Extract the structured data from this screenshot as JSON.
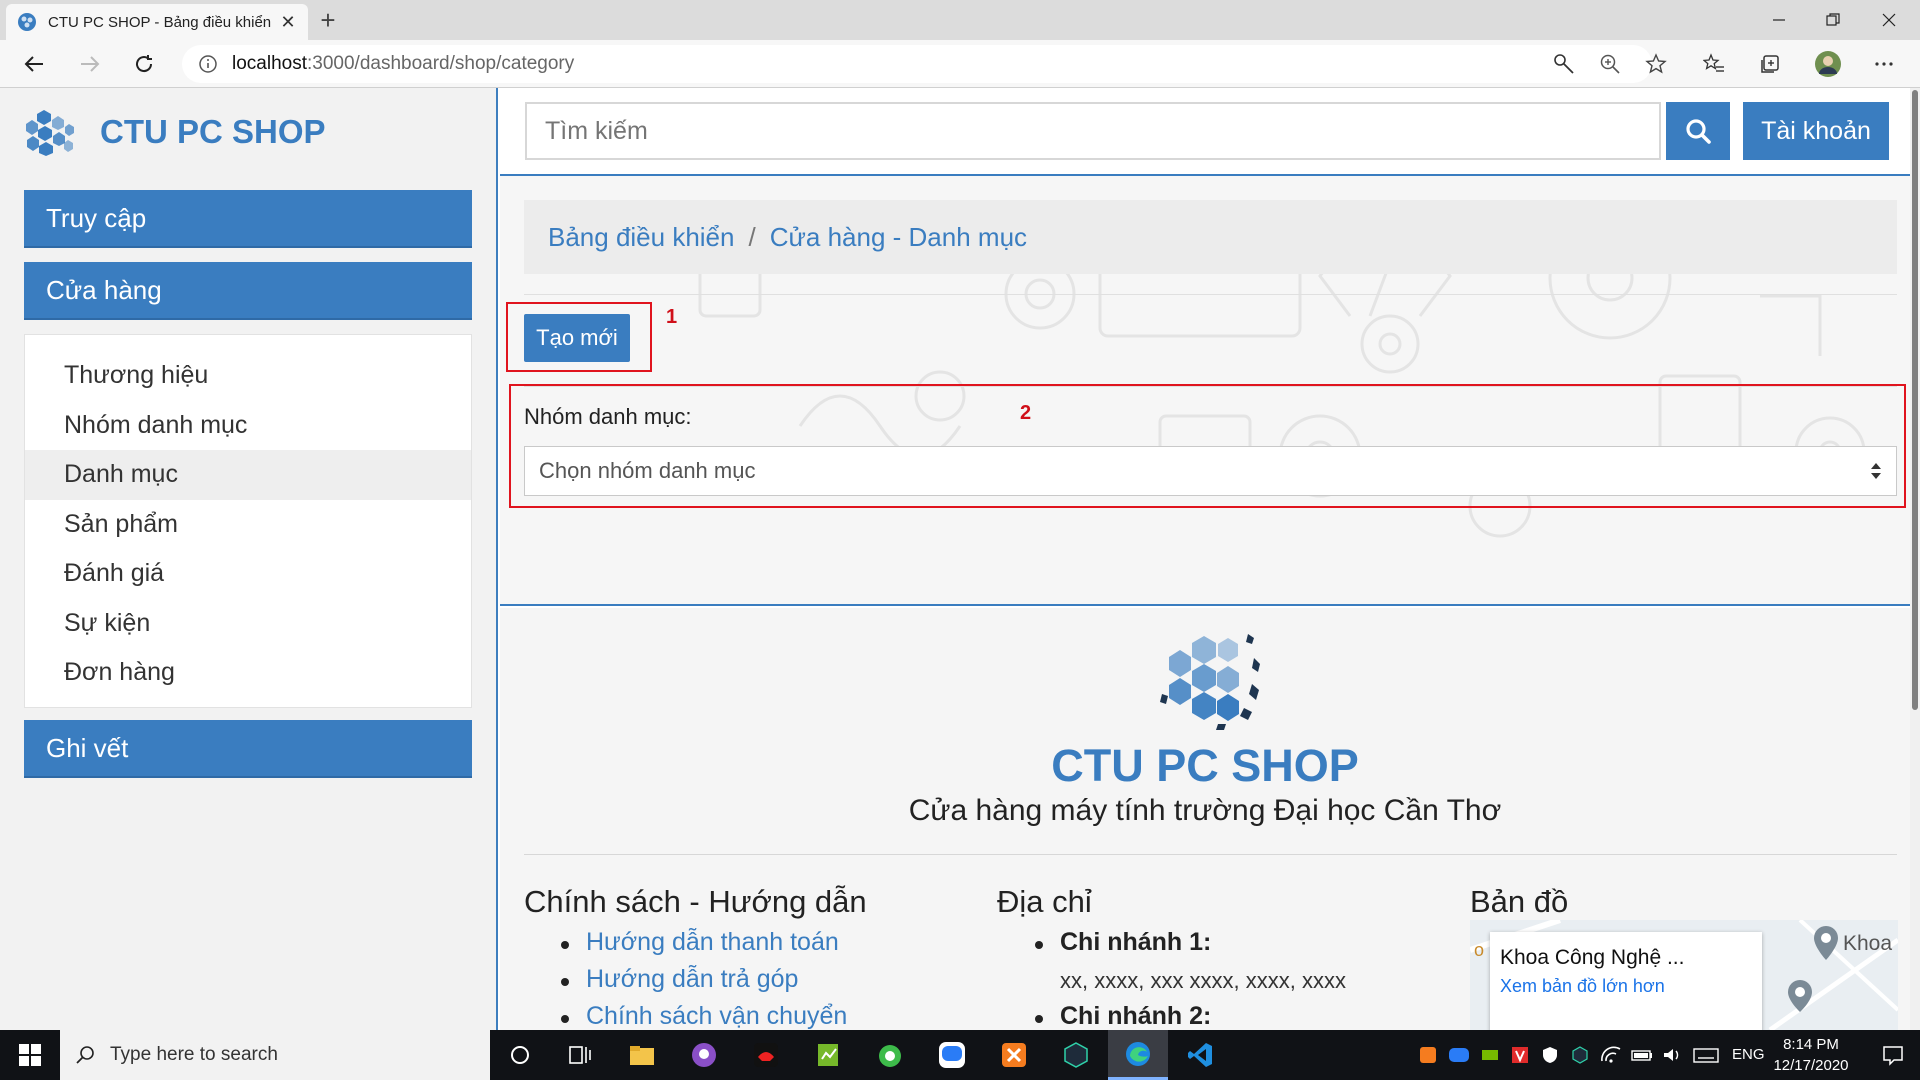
{
  "browser": {
    "tab_title": "CTU PC SHOP - Bảng điều khiển",
    "url_host": "localhost",
    "url_rest": ":3000/dashboard/shop/category"
  },
  "sidebar": {
    "brand": "CTU PC SHOP",
    "top_buttons": [
      {
        "label": "Truy cập"
      },
      {
        "label": "Cửa hàng"
      }
    ],
    "items": [
      {
        "label": "Thương hiệu"
      },
      {
        "label": "Nhóm danh mục"
      },
      {
        "label": "Danh mục"
      },
      {
        "label": "Sản phẩm"
      },
      {
        "label": "Đánh giá"
      },
      {
        "label": "Sự kiện"
      },
      {
        "label": "Đơn hàng"
      }
    ],
    "active_item": "Danh mục",
    "bottom_button": "Ghi vết"
  },
  "header": {
    "search_placeholder": "Tìm kiếm",
    "account_label": "Tài khoản"
  },
  "content": {
    "breadcrumb": [
      "Bảng điều khiển",
      "Cửa hàng - Danh mục"
    ],
    "breadcrumb_sep": "/",
    "create_label": "Tạo mới",
    "annotation_1": "1",
    "annotation_2": "2",
    "group_label": "Nhóm danh mục:",
    "group_select_placeholder": "Chọn nhóm danh mục"
  },
  "footer": {
    "brand": "CTU PC SHOP",
    "tagline": "Cửa hàng máy tính trường Đại học Cần Thơ",
    "col1_title": "Chính sách - Hướng dẫn",
    "col1_links": [
      "Hướng dẫn thanh toán",
      "Hướng dẫn trả góp",
      "Chính sách vận chuyển"
    ],
    "col2_title": "Địa chỉ",
    "branch1_label": "Chi nhánh 1:",
    "branch1_address": "xx, xxxx, xxx xxxx, xxxx, xxxx",
    "branch2_label": "Chi nhánh 2:",
    "col3_title": "Bản đồ",
    "map_place": "Khoa Công Nghệ ...",
    "map_link": "Xem bản đồ lớn hơn",
    "map_label": "Khoa",
    "map_edge_letter": "o"
  },
  "taskbar": {
    "search_placeholder": "Type here to search",
    "lang": "ENG",
    "time": "8:14 PM",
    "date": "12/17/2020"
  },
  "colors": {
    "primary": "#3a7dc0",
    "annotation_red": "#e0141e",
    "sidebar_bg": "#f2f2f2"
  }
}
